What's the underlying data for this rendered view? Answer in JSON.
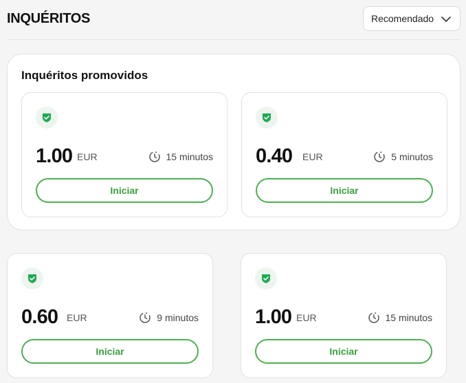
{
  "header": {
    "title": "INQUÉRITOS",
    "sort": {
      "selected": "Recomendado",
      "icon": "chevron-down-icon"
    }
  },
  "promoted": {
    "title": "Inquéritos promovidos",
    "cards": [
      {
        "price": "1.00",
        "currency": "EUR",
        "duration": "15 minutos",
        "button": "Iniciar"
      },
      {
        "price": "0.40",
        "currency": "EUR",
        "duration": "5 minutos",
        "button": "Iniciar"
      }
    ]
  },
  "surveys": [
    {
      "price": "0.60",
      "currency": "EUR",
      "duration": "9 minutos",
      "button": "Iniciar"
    },
    {
      "price": "1.00",
      "currency": "EUR",
      "duration": "15 minutos",
      "button": "Iniciar"
    }
  ],
  "colors": {
    "accent_green": "#4caf50",
    "shield_green": "#1faa54",
    "badge_bg": "#eef5ef"
  }
}
